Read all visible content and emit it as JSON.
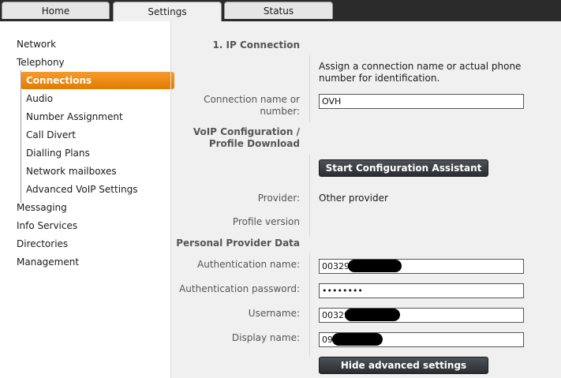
{
  "tabs": {
    "home": "Home",
    "settings": "Settings",
    "status": "Status"
  },
  "sidebar": {
    "network": "Network",
    "telephony": "Telephony",
    "telephony_items": {
      "connections": "Connections",
      "audio": "Audio",
      "number_assignment": "Number Assignment",
      "call_divert": "Call Divert",
      "dialling_plans": "Dialling Plans",
      "network_mailboxes": "Network mailboxes",
      "advanced_voip": "Advanced VoIP Settings"
    },
    "messaging": "Messaging",
    "info_services": "Info Services",
    "directories": "Directories",
    "management": "Management"
  },
  "content": {
    "section_ip": "1. IP Connection",
    "assign_help": "Assign a connection name or actual phone number for identification.",
    "connection_name_label": "Connection name or number:",
    "connection_name_value": "OVH",
    "voip_section": "VoIP Configuration / Profile Download",
    "start_assistant_button": "Start Configuration Assistant",
    "provider_label": "Provider:",
    "provider_value": "Other provider",
    "profile_version_label": "Profile version",
    "personal_section": "Personal Provider Data",
    "auth_name_label": "Authentication name:",
    "auth_name_value": "00329",
    "auth_password_label": "Authentication password:",
    "auth_password_value": "••••••••",
    "username_label": "Username:",
    "username_value": "00329",
    "display_name_label": "Display name:",
    "display_name_value": "09",
    "hide_advanced_button": "Hide advanced settings"
  }
}
